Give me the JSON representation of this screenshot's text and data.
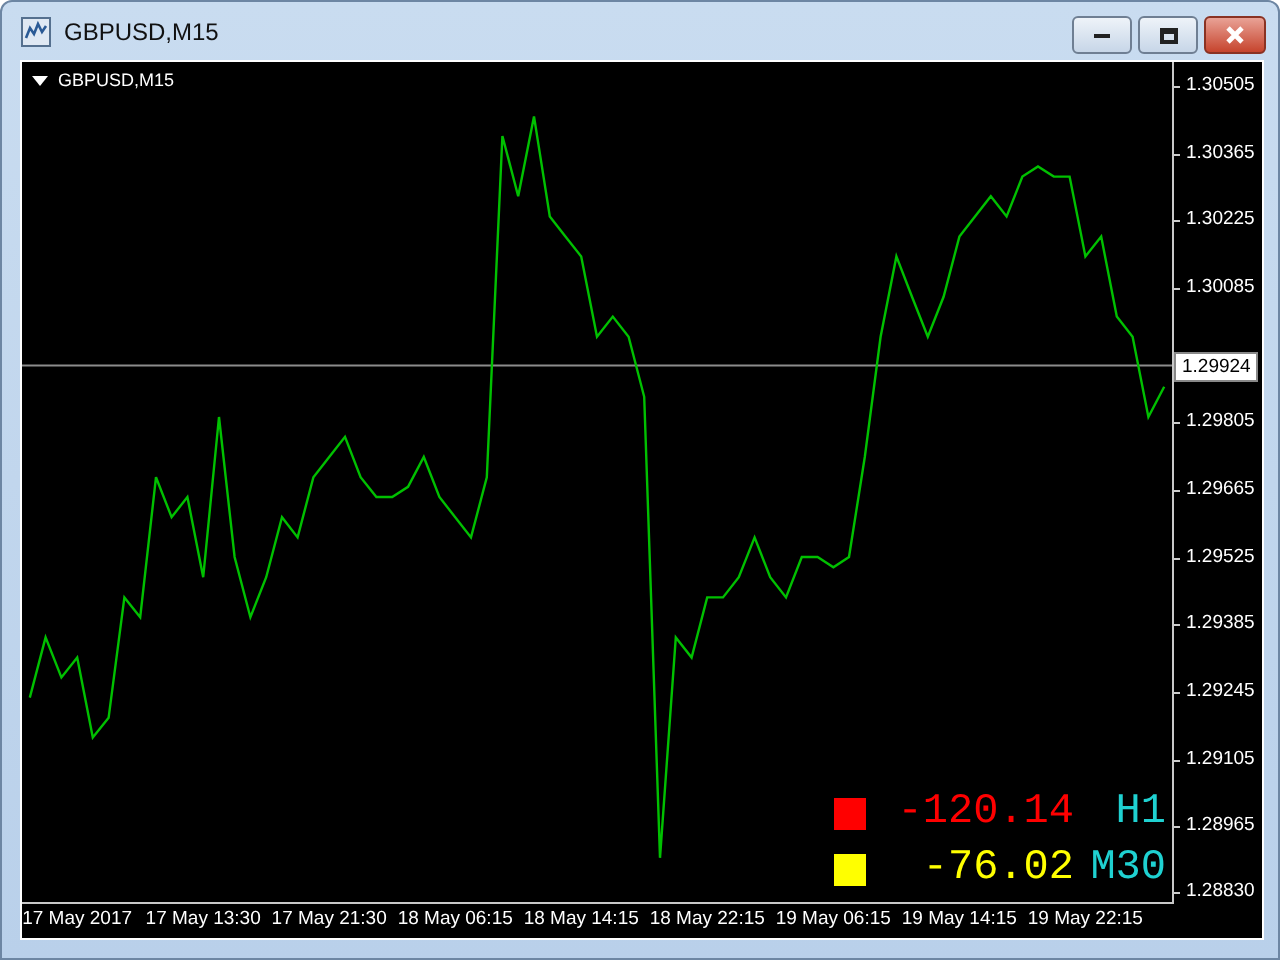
{
  "window": {
    "title": "GBPUSD,M15",
    "buttons": [
      {
        "kind": "minimize"
      },
      {
        "kind": "maximize"
      },
      {
        "kind": "close"
      }
    ]
  },
  "chart": {
    "label": "GBPUSD,M15",
    "chart_data": {
      "type": "line",
      "ylim": [
        1.28809,
        1.30555
      ],
      "ref_lines": [
        {
          "axis": "y",
          "value": 1.29924,
          "label": "1.29924"
        }
      ],
      "categories": [
        null,
        null,
        null,
        "17 May 2017",
        null,
        null,
        null,
        null,
        null,
        null,
        null,
        "17 May 13:30",
        null,
        null,
        null,
        null,
        null,
        null,
        null,
        "17 May 21:30",
        null,
        null,
        null,
        null,
        null,
        null,
        null,
        "18 May 06:15",
        null,
        null,
        null,
        null,
        null,
        null,
        null,
        "18 May 14:15",
        null,
        null,
        null,
        null,
        null,
        null,
        null,
        "18 May 22:15",
        null,
        null,
        null,
        null,
        null,
        null,
        null,
        "19 May 06:15",
        null,
        null,
        null,
        null,
        null,
        null,
        null,
        "19 May 14:15",
        null,
        null,
        null,
        null,
        null,
        null,
        null,
        "19 May 22:15",
        null,
        null,
        null,
        null,
        null
      ],
      "series": [
        {
          "color": "#00c000",
          "values": [
            1.29234,
            1.29359,
            1.29276,
            1.29317,
            1.29151,
            1.29192,
            1.29442,
            1.29401,
            1.29692,
            1.29609,
            1.29651,
            1.29484,
            1.29817,
            1.29526,
            1.29401,
            1.29484,
            1.29609,
            1.29567,
            1.29692,
            1.29734,
            1.29776,
            1.29692,
            1.29651,
            1.29651,
            1.29672,
            1.29734,
            1.29651,
            1.29609,
            1.29567,
            1.29692,
            1.30401,
            1.30276,
            1.30442,
            1.30234,
            1.30192,
            1.30151,
            1.29984,
            1.30026,
            1.29984,
            1.29859,
            1.28901,
            1.29359,
            1.29317,
            1.29442,
            1.29442,
            1.29484,
            1.29567,
            1.29484,
            1.29442,
            1.29526,
            1.29526,
            1.29505,
            1.29526,
            1.29734,
            1.29984,
            1.30151,
            1.30067,
            1.29984,
            1.30067,
            1.30192,
            1.30234,
            1.30276,
            1.30234,
            1.30317,
            1.30338,
            1.30317,
            1.30317,
            1.30151,
            1.30192,
            1.30026,
            1.29984,
            1.29817,
            1.2988
          ]
        }
      ],
      "yticks": [
        {
          "value": 1.30505,
          "label": "1.30505"
        },
        {
          "value": 1.30365,
          "label": "1.30365"
        },
        {
          "value": 1.30225,
          "label": "1.30225"
        },
        {
          "value": 1.30085,
          "label": "1.30085"
        },
        {
          "value": 1.29805,
          "label": "1.29805"
        },
        {
          "value": 1.29665,
          "label": "1.29665"
        },
        {
          "value": 1.29525,
          "label": "1.29525"
        },
        {
          "value": 1.29385,
          "label": "1.29385"
        },
        {
          "value": 1.29245,
          "label": "1.29245"
        },
        {
          "value": 1.29105,
          "label": "1.29105"
        },
        {
          "value": 1.28965,
          "label": "1.28965"
        },
        {
          "value": 1.2883,
          "label": "1.28830"
        }
      ]
    },
    "indicator": [
      {
        "color": "#ff0000",
        "value": "-120.14",
        "timeframe": "H1"
      },
      {
        "color": "#ffff00",
        "value": "-76.02",
        "timeframe": "M30"
      }
    ]
  }
}
